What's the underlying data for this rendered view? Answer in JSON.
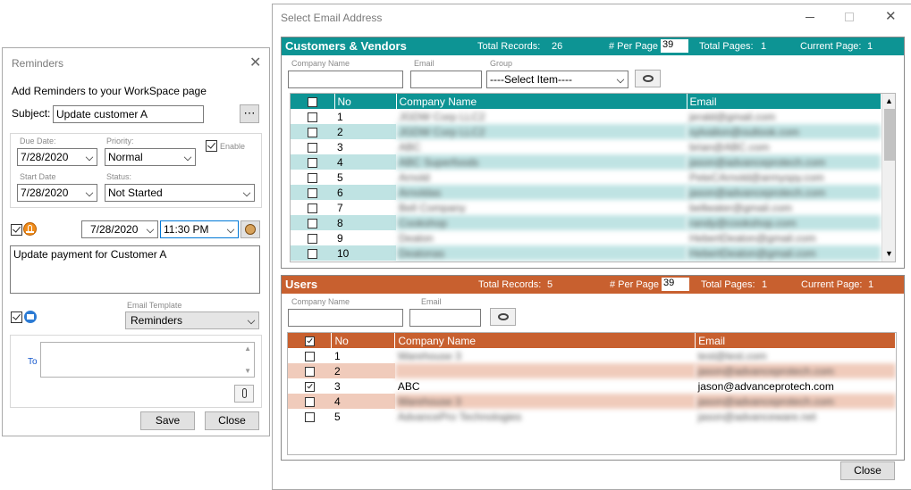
{
  "reminders": {
    "title": "Reminders",
    "heading": "Add Reminders to your WorkSpace page",
    "subject_label": "Subject:",
    "subject_value": "Update customer A",
    "more_label": "⋯",
    "due_date_label": "Due Date:",
    "due_date": "7/28/2020",
    "priority_label": "Priority:",
    "priority": "Normal",
    "enable_label": "Enable",
    "start_date_label": "Start Date",
    "start_date": "7/28/2020",
    "status_label": "Status:",
    "status": "Not Started",
    "alarm_date": "7/28/2020",
    "alarm_time": "11:30 PM",
    "note": "Update payment for Customer A",
    "email_template_label": "Email Template",
    "email_template": "Reminders",
    "to_label": "To",
    "save_label": "Save",
    "close_label": "Close"
  },
  "select_email": {
    "title": "Select Email Address",
    "close_label": "Close",
    "customers": {
      "title": "Customers & Vendors",
      "total_records_label": "Total Records:",
      "total_records": "26",
      "per_page_label": "# Per Page",
      "per_page": "39",
      "total_pages_label": "Total Pages:",
      "total_pages": "1",
      "current_page_label": "Current Page:",
      "current_page": "1",
      "company_name_label": "Company Name",
      "email_label": "Email",
      "group_label": "Group",
      "group_value": "----Select Item----",
      "columns": [
        "No",
        "Company Name",
        "Email"
      ],
      "rows": [
        {
          "no": "1",
          "company": "JGDW Corp LLC2",
          "email": "jerald@gmail.com"
        },
        {
          "no": "2",
          "company": "JGDW Corp LLC2",
          "email": "sylvalion@outlook.com"
        },
        {
          "no": "3",
          "company": "ABC",
          "email": "brian@ABC.com"
        },
        {
          "no": "4",
          "company": "ABC Superfoods",
          "email": "jason@advanceprotech.com"
        },
        {
          "no": "5",
          "company": "Arnold",
          "email": "PeteCArnold@armyspy.com"
        },
        {
          "no": "6",
          "company": "Arnoldas",
          "email": "jason@advanceprotech.com"
        },
        {
          "no": "7",
          "company": "Bell Company",
          "email": "bellwater@gmail.com"
        },
        {
          "no": "8",
          "company": "Cookshop",
          "email": "randy@cookshop.com"
        },
        {
          "no": "9",
          "company": "Deaton",
          "email": "HebertDeaton@gmail.com"
        },
        {
          "no": "10",
          "company": "Deatonas",
          "email": "HebertDeaton@gmail.com"
        }
      ]
    },
    "users": {
      "title": "Users",
      "total_records_label": "Total Records:",
      "total_records": "5",
      "per_page_label": "# Per Page",
      "per_page": "39",
      "total_pages_label": "Total Pages:",
      "total_pages": "1",
      "current_page_label": "Current Page:",
      "current_page": "1",
      "company_name_label": "Company Name",
      "email_label": "Email",
      "columns": [
        "No",
        "Company Name",
        "Email"
      ],
      "rows": [
        {
          "no": "1",
          "company": "Warehouse 3",
          "email": "test@test.com",
          "checked": false,
          "blur": true
        },
        {
          "no": "2",
          "company": "",
          "email": "jason@advanceprotech.com",
          "checked": false,
          "blur": true
        },
        {
          "no": "3",
          "company": "ABC",
          "email": "jason@advanceprotech.com",
          "checked": true,
          "blur": false
        },
        {
          "no": "4",
          "company": "Warehouse 3",
          "email": "jason@advanceprotech.com",
          "checked": false,
          "blur": true
        },
        {
          "no": "5",
          "company": "AdvancePro Technologies",
          "email": "jason@advanceware.net",
          "checked": false,
          "blur": true
        }
      ]
    }
  },
  "colors": {
    "teal": "#0d9494",
    "rust": "#c8602f",
    "teal_alt": "#bfe3e3",
    "rust_alt": "#f0cbbb"
  }
}
